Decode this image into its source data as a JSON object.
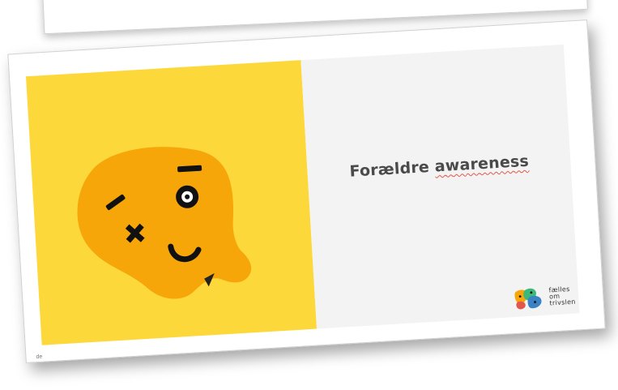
{
  "slide": {
    "title_plain": "Forældre ",
    "title_underlined": "awareness",
    "logo_lines": [
      "fælles",
      "om",
      "trivslen"
    ],
    "footer_stub": "de"
  },
  "colors": {
    "panel_yellow": "#fdd83a",
    "mascot_orange": "#f6a609",
    "panel_gray": "#f3f3f3",
    "title_text": "#4a4a4a",
    "spellcheck_red": "#e2574c"
  },
  "icons": {
    "mascot": "dizzy-face-mascot-icon",
    "logo": "faelles-om-trivslen-logo-icon"
  }
}
